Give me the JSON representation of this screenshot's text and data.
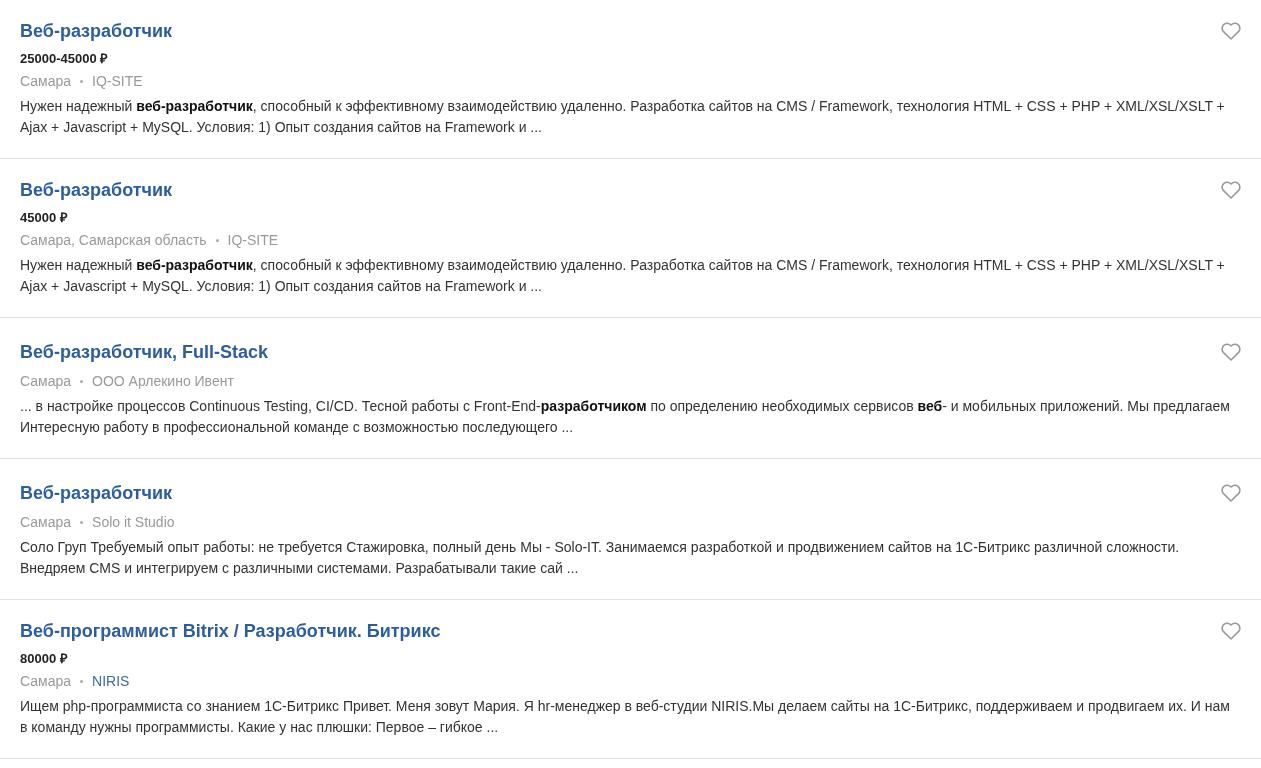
{
  "vacancies": [
    {
      "title": "Веб-разработчик",
      "salary": "25000-45000 ₽",
      "city": "Самара",
      "company": {
        "name": "IQ-SITE",
        "link": false
      },
      "description": "Нужен надежный **веб-разработчик**, способный к эффективному взаимодействию удаленно. Разработка сайтов на CMS / Framework, технология HTML + CSS + PHP + XML/XSL/XSLT + Ajax + Javascript + MySQL. Условия: 1) Опыт создания сайтов на Framework и ...",
      "favorite": false
    },
    {
      "title": "Веб-разработчик",
      "salary": "45000 ₽",
      "city": "Самара, Самарская область",
      "company": {
        "name": "IQ-SITE",
        "link": false
      },
      "description": "Нужен надежный **веб-разработчик**, способный к эффективному взаимодействию удаленно. Разработка сайтов на CMS / Framework, технология HTML + CSS + PHP + XML/XSL/XSLT + Ajax + Javascript + MySQL. Условия: 1) Опыт создания сайтов на Framework и ...",
      "favorite": false
    },
    {
      "title": "Веб-разработчик, Full-Stack",
      "city": "Самара",
      "company": {
        "name": "ООО Арлекино Ивент",
        "link": false
      },
      "description": "... в настройке процессов Continuous Testing, CI/CD. Тесной работы с Front-End-**разработчиком** по определению необходимых сервисов **веб**- и мобильных приложений. Мы предлагаем Интересную работу в профессиональной команде с возможностью последующего ...",
      "favorite": false
    },
    {
      "title": "Веб-разработчик",
      "city": "Самара",
      "company": {
        "name": "Solo it Studio",
        "link": false
      },
      "description": "Соло Груп Требуемый опыт работы: не требуется Стажировка, полный день Мы - Solo-IT. Занимаемся разработкой и продвижением сайтов на 1С-Битрикс различной сложности. Внедряем CMS и интегрируем с различными системами. Разрабатывали такие сай ...",
      "favorite": false
    },
    {
      "title": "Веб-программист Bitrix / Разработчик. Битрикс",
      "salary": "80000 ₽",
      "city": "Самара",
      "company": {
        "name": "NIRIS",
        "link": true
      },
      "description": "Ищем php-программиста со знанием 1С-Битрикс Привет. Меня зовут Мария. Я hr-менеджер в веб-студии NIRIS.Мы делаем сайты на 1С-Битрикс, поддерживаем и продвигаем их. И нам в команду нужны программисты. Какие у нас плюшки: Первое – гибкое ...",
      "favorite": false
    }
  ]
}
